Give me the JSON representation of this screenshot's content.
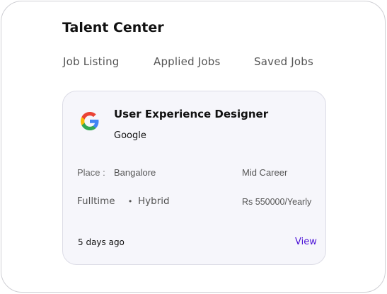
{
  "page": {
    "title": "Talent Center"
  },
  "tabs": [
    {
      "label": "Job Listing"
    },
    {
      "label": "Applied Jobs"
    },
    {
      "label": "Saved Jobs"
    }
  ],
  "job": {
    "title": "User Experience Designer",
    "company": "Google",
    "logo_icon": "google-logo",
    "place_label": "Place :",
    "place": "Bangalore",
    "level": "Mid Career",
    "type": "Fulltime",
    "separator": "•",
    "mode": "Hybrid",
    "salary": "Rs 550000/Yearly",
    "posted": "5 days ago",
    "view_label": "View"
  },
  "colors": {
    "accent": "#4a10d6",
    "card_bg": "#f6f6fb",
    "card_border": "#dcdce6",
    "panel_border": "#cfcfd4"
  }
}
